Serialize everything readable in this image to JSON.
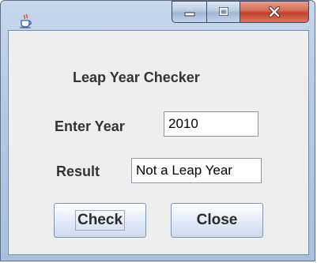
{
  "window": {
    "title": "",
    "app_icon": "java-cup-icon",
    "controls": {
      "minimize_icon": "minimize-icon",
      "maximize_icon": "maximize-icon",
      "close_icon": "close-icon"
    }
  },
  "form": {
    "heading": "Leap Year Checker",
    "year_label": "Enter Year",
    "year_value": "2010",
    "result_label": "Result",
    "result_value": "Not a Leap Year"
  },
  "buttons": {
    "check_label": "Check",
    "close_label": "Close"
  },
  "colors": {
    "window_frame": "#b5cae6",
    "client_bg": "#eeeeee",
    "close_button_red": "#c2412a"
  }
}
